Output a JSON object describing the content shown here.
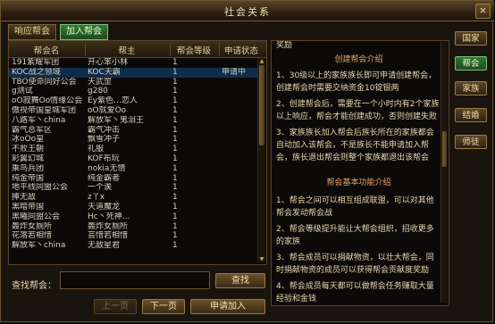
{
  "window": {
    "title": "社会关系",
    "close_label": "×"
  },
  "tabs": [
    {
      "label": "响应帮会",
      "active": false
    },
    {
      "label": "加入帮会",
      "active": true
    }
  ],
  "table": {
    "headers": [
      "帮会名",
      "帮主",
      "帮会等级",
      "申请状态"
    ],
    "rows": [
      {
        "name": "191紫耀军团",
        "leader": "开心笨小林",
        "level": "1",
        "status": ""
      },
      {
        "name": "KOC战之领域",
        "leader": "KOC天霸",
        "level": "1",
        "status": "申请中"
      },
      {
        "name": "TBO使命同好公会",
        "leader": "天武罡",
        "level": "1",
        "status": ""
      },
      {
        "name": "g测试",
        "leader": "g280",
        "level": "1",
        "status": ""
      },
      {
        "name": "oO寂舞Oo情缘公会",
        "leader": "Ey紫色…恋人",
        "level": "1",
        "status": ""
      },
      {
        "name": "傲视帝国皇城军团",
        "leader": "oO就爱Oo",
        "level": "1",
        "status": ""
      },
      {
        "name": "八路军丶china",
        "leader": "解放军丶鬼泪王",
        "level": "1",
        "status": ""
      },
      {
        "name": "霸气总军区",
        "leader": "霸气冲击",
        "level": "1",
        "status": ""
      },
      {
        "name": "冰oOo皇",
        "leader": "飘雪冲子",
        "level": "1",
        "status": ""
      },
      {
        "name": "不败王朝",
        "leader": "礼服",
        "level": "1",
        "status": ""
      },
      {
        "name": "彩翼幻城",
        "leader": "KOF布玩",
        "level": "1",
        "status": ""
      },
      {
        "name": "乘鸟兵团",
        "leader": "nokia无情",
        "level": "1",
        "status": ""
      },
      {
        "name": "纯金帝国",
        "leader": "纯金霸者",
        "level": "1",
        "status": ""
      },
      {
        "name": "地平线同盟公会",
        "leader": "一个诶",
        "level": "1",
        "status": ""
      },
      {
        "name": "捧无敌",
        "leader": "z丫x",
        "level": "1",
        "status": ""
      },
      {
        "name": "黑暗帝国",
        "leader": "天道魔龙",
        "level": "1",
        "status": ""
      },
      {
        "name": "黑曦同盟公会",
        "leader": "Hc丶死神…",
        "level": "1",
        "status": ""
      },
      {
        "name": "轰炸女厕所",
        "leader": "轰炸女厕所",
        "level": "1",
        "status": ""
      },
      {
        "name": "花落若相惜",
        "leader": "芸惜若相惜",
        "level": "1",
        "status": ""
      },
      {
        "name": "解放军丶china",
        "leader": "无敌星君",
        "level": "1",
        "status": ""
      }
    ]
  },
  "search": {
    "label": "查找帮会：",
    "value": "",
    "button": "查找"
  },
  "pager": {
    "prev": "上一页",
    "next": "下一页",
    "apply": "申请加入"
  },
  "info": {
    "lines": [
      {
        "text": "奖励",
        "section": false
      },
      {
        "text": "创建帮会介绍",
        "section": true
      },
      {
        "text": "1、30级以上的家族族长即可申请创建帮会，创建帮会时需要交纳资金10锭银两",
        "section": false
      },
      {
        "text": "2、创建帮会后，需要在一个小时内有2个家族以上响应，帮会才能创建成功，否则创建失败",
        "section": false
      },
      {
        "text": "3、家族族长加入帮会后族长所在的家族都会自动加入该帮会，不是族长不能申请加入帮会，族长退出帮会则整个家族都退出该帮会",
        "section": false
      },
      {
        "text": "帮会基本功能介绍",
        "section": true
      },
      {
        "text": "1、帮会之间可以相互组成联盟，可以对其他帮会发动帮会战",
        "section": false
      },
      {
        "text": "2、帮会等级提升能让大帮会组织，招收更多的家族",
        "section": false
      },
      {
        "text": "3、帮会成员可以捐献物资，以壮大帮会，同时捐献物资的成员可以获得帮会贡献度奖励",
        "section": false
      },
      {
        "text": "4、帮会成员每天都可以做帮会任务赚取大量经验和金钱",
        "section": false
      }
    ]
  },
  "side_tabs": [
    {
      "label": "国家",
      "active": false
    },
    {
      "label": "帮会",
      "active": true
    },
    {
      "label": "家族",
      "active": false
    },
    {
      "label": "结婚",
      "active": false
    },
    {
      "label": "师徒",
      "active": false
    }
  ],
  "colors": {
    "accent_green": "#2e7a33",
    "section_text": "#e8a46a",
    "selected_row": "#0f2d4a"
  }
}
